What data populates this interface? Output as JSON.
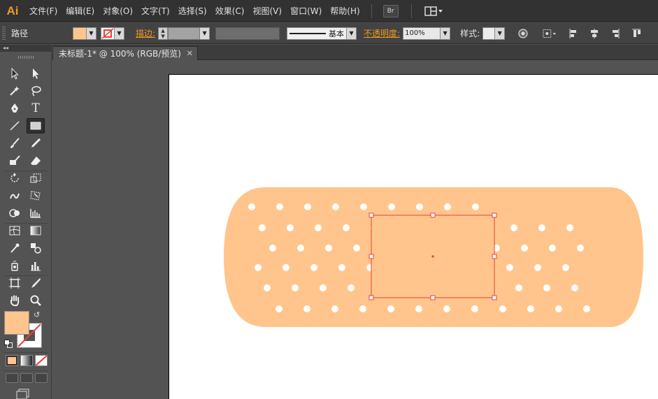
{
  "app": {
    "logo": "Ai"
  },
  "menu": {
    "items": [
      "文件(F)",
      "编辑(E)",
      "对象(O)",
      "文字(T)",
      "选择(S)",
      "效果(C)",
      "视图(V)",
      "窗口(W)",
      "帮助(H)"
    ],
    "bridge_label": "Br"
  },
  "control": {
    "selection_type": "路径",
    "stroke_label": "描边:",
    "stroke_profile_label": "基本",
    "opacity_label": "不透明度:",
    "opacity_value": "100%",
    "style_label": "样式:"
  },
  "tools": {
    "collapse_glyph": "◂◂"
  },
  "document": {
    "tab_title": "未标题-1* @ 100% (RGB/预览)",
    "close_glyph": "✕"
  },
  "colors": {
    "fill": "#ffc58c",
    "selection": "#e8403a",
    "accent": "#f29a22",
    "artboard": "#ffffff"
  },
  "artwork": {
    "shape": "bandage",
    "hole_rows": [
      9,
      12,
      12,
      12,
      12,
      12
    ],
    "selected_object": "rectangle"
  }
}
